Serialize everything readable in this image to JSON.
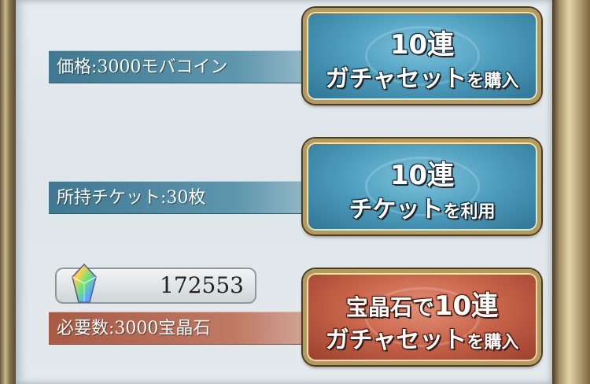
{
  "rows": [
    {
      "label": "価格:3000モバコイン",
      "button": {
        "line1": "10連",
        "line2_main": "ガチャセット",
        "line2_suffix": "を購入"
      }
    },
    {
      "label": "所持チケット:30枚",
      "button": {
        "line1": "10連",
        "line2_main": "チケット",
        "line2_suffix": "を利用"
      }
    },
    {
      "label": "必要数:3000宝晶石",
      "button": {
        "line1_prefix": "宝晶石で",
        "line1": "10連",
        "line2_main": "ガチャセット",
        "line2_suffix": "を購入"
      }
    }
  ],
  "crystal_balance": "172553",
  "colors": {
    "blue_button": "#4f9fbf",
    "red_button": "#c9664c",
    "blue_label": "#3f7890",
    "red_label": "#a95a45"
  }
}
